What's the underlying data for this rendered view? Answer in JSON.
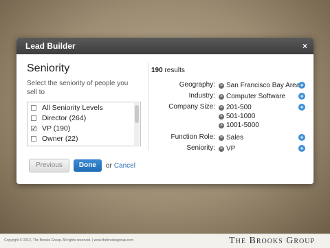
{
  "modal": {
    "title": "Lead Builder",
    "close_glyph": "×"
  },
  "left": {
    "heading": "Seniority",
    "description": "Select the seniority of people you sell to",
    "options": [
      {
        "label": "All Seniority Levels",
        "checked": false
      },
      {
        "label": "Director (264)",
        "checked": false
      },
      {
        "label": "VP (190)",
        "checked": true
      },
      {
        "label": "Owner (22)",
        "checked": false
      }
    ]
  },
  "results": {
    "count": "190",
    "label": "results"
  },
  "filters": [
    {
      "label": "Geography:",
      "values": [
        "San Francisco Bay Area"
      ]
    },
    {
      "label": "Industry:",
      "values": [
        "Computer Software"
      ]
    },
    {
      "label": "Company Size:",
      "values": [
        "201-500",
        "501-1000",
        "1001-5000"
      ]
    },
    {
      "label": "Function Role:",
      "values": [
        "Sales"
      ]
    },
    {
      "label": "Seniority:",
      "values": [
        "VP"
      ]
    }
  ],
  "buttons": {
    "previous": "Previous",
    "done": "Done",
    "or": "or",
    "cancel": "Cancel"
  },
  "footer": {
    "copyright": "Copyright © 2012, The Brooks Group. All rights reserved. | www.thebrooksgroup.com",
    "brand": "The Brooks Group"
  },
  "icons": {
    "remove": "remove-circle-icon",
    "add": "add-circle-icon",
    "check": "checkmark-icon"
  },
  "colors": {
    "accent": "#2a6fb8",
    "titlebar": "#4a4a4a",
    "done_button": "#2672c0"
  }
}
